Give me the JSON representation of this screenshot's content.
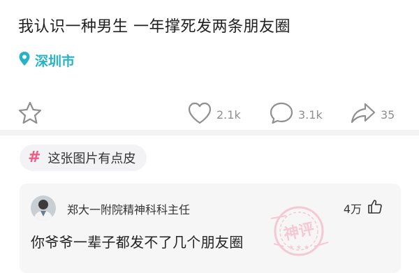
{
  "post": {
    "title": "我认识一种男生 一年撑死发两条朋友圈",
    "location": "深圳市",
    "location_icon": "location-pin-icon",
    "accent_color": "#27b3c6"
  },
  "actions": {
    "likes": "2.1k",
    "comments": "3.1k",
    "shares": "35"
  },
  "topic": {
    "label": "这张图片有点皮",
    "hash_color": "#ef5a86"
  },
  "top_comment": {
    "user": "郑大一附院精神科科主任",
    "likes": "4万",
    "text": "你爷爷一辈子都发不了几个朋友圈",
    "stamp_text": "神评",
    "stamp_color": "#f3a6b8"
  }
}
